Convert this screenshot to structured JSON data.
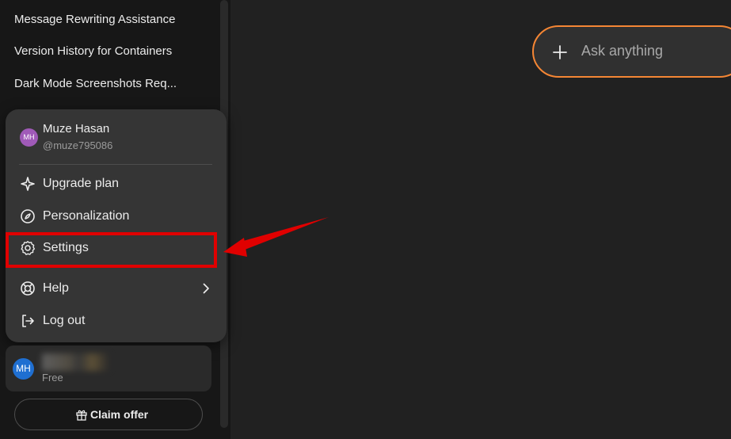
{
  "sidebar": {
    "chats": [
      {
        "title": "Message Rewriting Assistance"
      },
      {
        "title": "Version History for Containers"
      },
      {
        "title": "Dark Mode Screenshots Req..."
      }
    ]
  },
  "menu": {
    "user_initials": "MH",
    "user_name": "Muze Hasan",
    "user_handle": "@muze795086",
    "items": [
      {
        "label": "Upgrade plan",
        "icon": "sparkle-icon"
      },
      {
        "label": "Personalization",
        "icon": "personalization-icon"
      },
      {
        "label": "Settings",
        "icon": "gear-icon"
      },
      {
        "label": "Help",
        "icon": "lifebuoy-icon"
      },
      {
        "label": "Log out",
        "icon": "logout-icon"
      }
    ]
  },
  "account": {
    "initials": "MH",
    "plan": "Free"
  },
  "claim_offer": {
    "label": "Claim offer"
  },
  "composer": {
    "placeholder": "Ask anything"
  },
  "colors": {
    "annotation_red": "#e00000",
    "composer_border": "#f58634",
    "avatar_purple": "#a05ab8",
    "avatar_blue": "#1f6fd1"
  }
}
